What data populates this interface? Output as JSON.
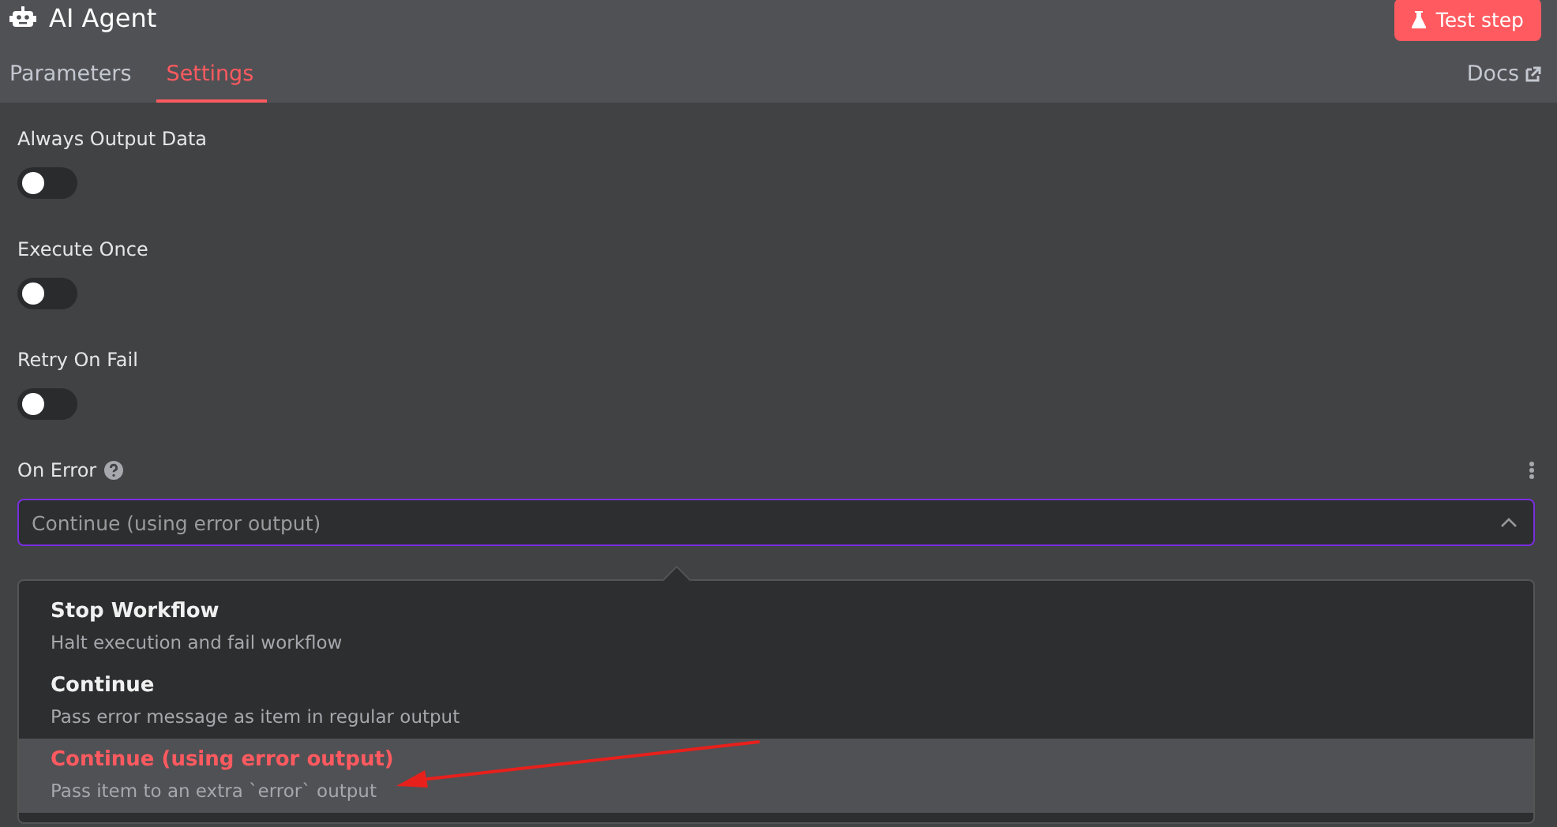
{
  "header": {
    "title": "AI Agent",
    "test_button": "Test step"
  },
  "tabs": [
    {
      "label": "Parameters",
      "selected": false
    },
    {
      "label": "Settings",
      "selected": true
    }
  ],
  "docs_link": "Docs",
  "toggles": [
    {
      "label": "Always Output Data",
      "on": false
    },
    {
      "label": "Execute Once",
      "on": false
    },
    {
      "label": "Retry On Fail",
      "on": false
    }
  ],
  "on_error": {
    "label": "On Error",
    "placeholder": "Continue (using error output)",
    "expanded": true,
    "options": [
      {
        "title": "Stop Workflow",
        "description": "Halt execution and fail workflow",
        "selected": false
      },
      {
        "title": "Continue",
        "description": "Pass error message as item in regular output",
        "selected": false
      },
      {
        "title": "Continue (using error output)",
        "description": "Pass item to an extra `error` output",
        "selected": true
      }
    ]
  }
}
